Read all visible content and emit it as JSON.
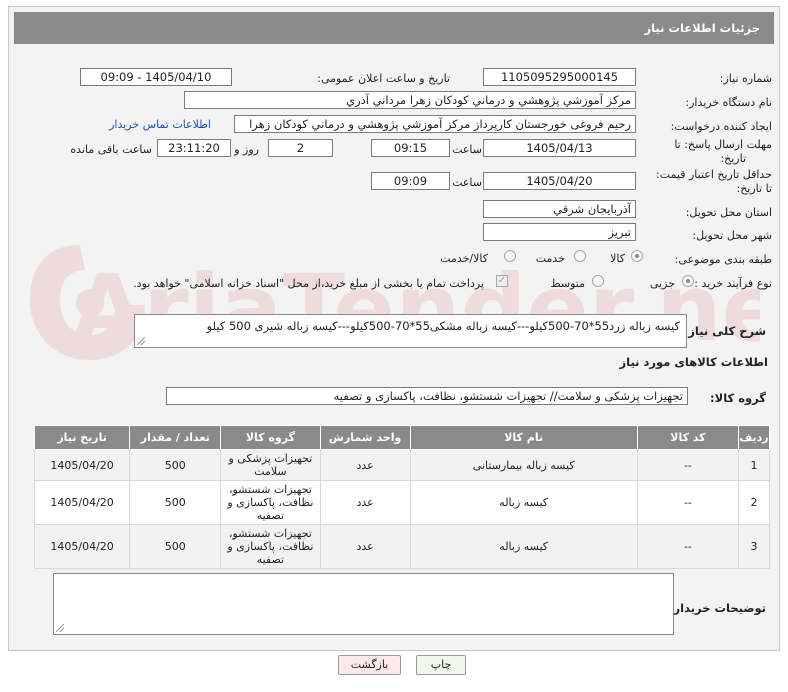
{
  "header": {
    "title": "جزئیات اطلاعات نیاز"
  },
  "form": {
    "need_number_label": "شماره نیاز:",
    "need_number": "1105095295000145",
    "announce_label": "تاریخ و ساعت اعلان عمومی:",
    "announce_value": "1405/04/10 - 09:09",
    "buyer_org_label": "نام دستگاه خریدار:",
    "buyer_org": "مرکز آموزشي پژوهشي و درماني كودكان زهرا مرداني آذري",
    "creator_label": "ایجاد کننده درخواست:",
    "creator": "رحیم فروغی خورجستان کارپرداز مرکز آموزشي پژوهشي و درماني كودكان زهرا",
    "contact_link": "اطلاعات تماس خریدار",
    "deadline_label_1": "مهلت ارسال پاسخ: تا",
    "deadline_label_2": "تاریخ:",
    "deadline_date": "1405/04/13",
    "hour_label": "ساعت",
    "deadline_time": "09:15",
    "days_value": "2",
    "days_label": "روز و",
    "remaining_time": "23:11:20",
    "remaining_label": "ساعت باقی مانده",
    "validity_label_1": "حداقل تاریخ اعتبار قیمت:",
    "validity_label_2": "تا تاریخ:",
    "validity_date": "1405/04/20",
    "validity_time": "09:09",
    "province_label": "استان محل تحویل:",
    "province": "آذربايجان شرقي",
    "city_label": "شهر محل تحویل:",
    "city": "تبریز",
    "category_label": "طبقه بندی موضوعی:",
    "category_options": [
      "کالا",
      "خدمت",
      "کالا/خدمت"
    ],
    "process_label": "نوع فرآیند خرید :",
    "process_options": [
      "جزیی",
      "متوسط"
    ],
    "payment_note": "پرداخت تمام یا بخشی از مبلغ خرید،از محل \"اسناد خزانه اسلامی\" خواهد بود."
  },
  "description": {
    "label": "شرح کلی نیاز:",
    "text": "کیسه زباله زرد55*70-500کیلو---کیسه زباله مشکی55*70-500کیلو---کیسه زباله شیری 500 کیلو"
  },
  "goods_info": {
    "title": "اطلاعات کالاهای مورد نیاز",
    "group_label": "گروه کالا:",
    "group_value": "تجهیزات پزشکی و سلامت// تجهیزات شستشو، نظافت، پاکسازی و تصفیه"
  },
  "table": {
    "headers": [
      "ردیف",
      "کد کالا",
      "نام کالا",
      "واحد شمارش",
      "گروه کالا",
      "تعداد / مقدار",
      "تاریخ نیاز"
    ],
    "rows": [
      [
        "1",
        "--",
        "کیسه زباله بیمارستانی",
        "عدد",
        "تجهیزات پزشکی و سلامت",
        "500",
        "1405/04/20"
      ],
      [
        "2",
        "--",
        "کیسه زباله",
        "عدد",
        "تجهیزات شستشو، نظافت، پاکسازی و تصفیه",
        "500",
        "1405/04/20"
      ],
      [
        "3",
        "--",
        "کیسه زباله",
        "عدد",
        "تجهیزات شستشو، نظافت، پاکسازی و تصفیه",
        "500",
        "1405/04/20"
      ]
    ]
  },
  "buyer_notes": {
    "label": "توضیحات خریدار:",
    "text": ""
  },
  "buttons": {
    "print": "چاپ",
    "back": "بازگشت"
  },
  "watermark": {
    "text": "AriaTender.net"
  }
}
